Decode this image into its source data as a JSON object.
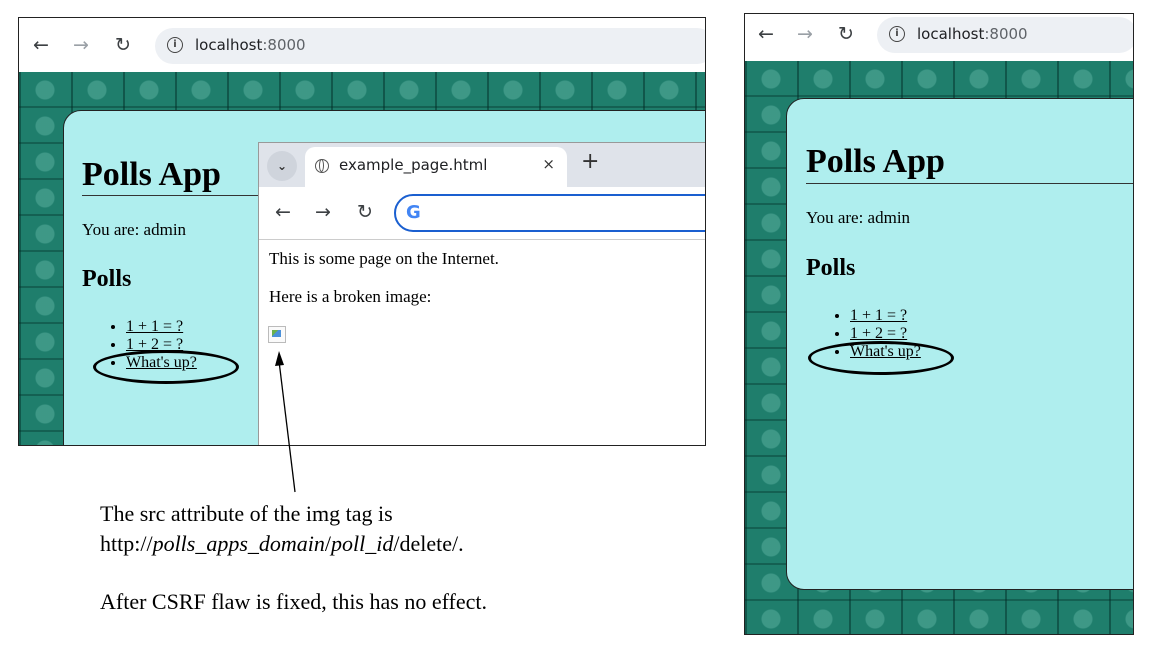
{
  "left_shot": {
    "url_host": "localhost",
    "url_port": ":8000",
    "polls": {
      "title": "Polls App",
      "user_line": "You are: admin",
      "heading": "Polls",
      "items": [
        "1 + 1 = ?",
        "1 + 2 = ?",
        "What's up?"
      ]
    },
    "popup": {
      "tab_title": "example_page.html",
      "tab_close": "×",
      "new_tab": "+",
      "content_line_1": "This is some page on the Internet.",
      "content_line_2": "Here is a broken image:"
    }
  },
  "right_shot": {
    "url_host": "localhost",
    "url_port": ":8000",
    "polls": {
      "title": "Polls App",
      "user_line": "You are: admin",
      "heading": "Polls",
      "items": [
        "1 + 1 = ?",
        "1 + 2 = ?",
        "What's up?"
      ]
    }
  },
  "annotation": {
    "line_1": "The src attribute of the img tag is",
    "line_2_prefix": "http://",
    "line_2_domain": "polls_apps_domain",
    "line_2_sep": "/",
    "line_2_poll": "poll_id",
    "line_2_suffix": "/delete/.",
    "line_3": "After CSRF flaw is fixed, this has no effect."
  },
  "icons": {
    "back": "back-arrow-icon",
    "forward": "forward-arrow-icon",
    "reload": "reload-icon",
    "info": "info-icon",
    "globe": "globe-icon",
    "google": "google-icon"
  }
}
